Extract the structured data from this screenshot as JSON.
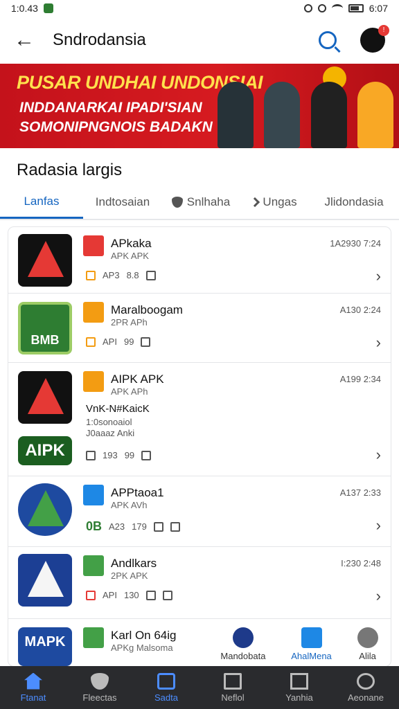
{
  "status": {
    "time": "1:0.43",
    "right_time": "6:07"
  },
  "appbar": {
    "title": "Sndrodansia"
  },
  "banner": {
    "title": "PUSAR UNDHAI UNDONSIAI",
    "line1": "INDDANARKAI IPADI'SIAN",
    "line2": "SOMONIPNGNOIS BADAKN"
  },
  "section_title": "Radasia largis",
  "tabs": [
    {
      "label": "Lanfas"
    },
    {
      "label": "Indtosaian"
    },
    {
      "label": "Snlhaha"
    },
    {
      "label": "Ungas"
    },
    {
      "label": "Jlidondasia"
    }
  ],
  "items": [
    {
      "name": "APkaka",
      "sub": "APK APK",
      "time": "1A2930 7:24",
      "meta1": "AP3",
      "meta2": "8.8"
    },
    {
      "name": "Maralboogam",
      "sub": "2PR APh",
      "time": "A130 2:24",
      "meta1": "API",
      "meta2": "99"
    },
    {
      "name": "AIPK APK",
      "sub": "APK APh",
      "time": "A199 2:34",
      "desc1": "VnK-N#KaicK",
      "desc2": "1:0sonoaiol",
      "desc3": "J0aaaz Anki",
      "meta1": "193",
      "meta2": "99",
      "logo_label": "AIPK"
    },
    {
      "name": "APPtaoa1",
      "sub": "APK AVh",
      "time": "A137 2:33",
      "meta_bold": "0B",
      "meta1": "A23",
      "meta2": "179"
    },
    {
      "name": "Andlkars",
      "sub": "2PK APK",
      "time": "I:230 2:48",
      "meta1": "API",
      "meta2": "130"
    },
    {
      "name": "Karl On 64ig",
      "sub": "APKg Malsoma",
      "logo_label": "MAPK"
    }
  ],
  "thumb2_label": "BMB",
  "fab": [
    {
      "label": "Mandobata"
    },
    {
      "label": "AhalMena"
    },
    {
      "label": "Alila"
    }
  ],
  "nav": [
    {
      "label": "Ftanat"
    },
    {
      "label": "Fleectas"
    },
    {
      "label": "Sadta"
    },
    {
      "label": "Neflol"
    },
    {
      "label": "Yanhia"
    },
    {
      "label": "Aeonane"
    }
  ]
}
